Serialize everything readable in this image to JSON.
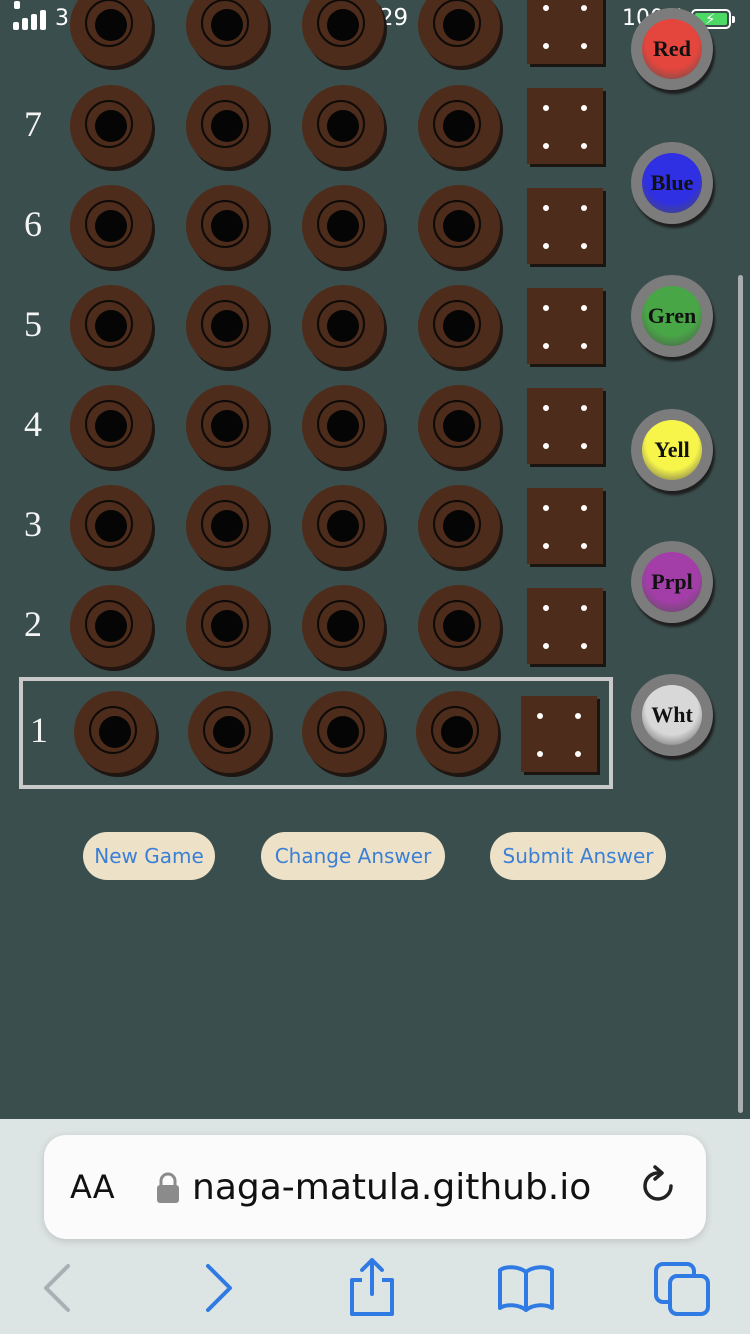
{
  "status_bar": {
    "carrier": "3",
    "time": "21:29",
    "battery_percent": "100%"
  },
  "board": {
    "row_labels": [
      "7",
      "6",
      "5",
      "4",
      "3",
      "2",
      "1"
    ],
    "active_row": "1"
  },
  "palette": {
    "colors": [
      {
        "label": "Red",
        "color": "#e4453d"
      },
      {
        "label": "Blue",
        "color": "#2f2fe4"
      },
      {
        "label": "Gren",
        "color": "#48a646"
      },
      {
        "label": "Yell",
        "color": "#f7f54a"
      },
      {
        "label": "Prpl",
        "color": "#a33ea8"
      },
      {
        "label": "Wht",
        "color": "#d8d8d8"
      }
    ]
  },
  "actions": {
    "new_game": "New Game",
    "change_answer": "Change Answer",
    "submit_answer": "Submit Answer"
  },
  "browser": {
    "text_size_label": "AA",
    "url": "naga-matula.github.io",
    "toolbar_icons": [
      "back-icon",
      "forward-icon",
      "share-icon",
      "bookmarks-icon",
      "tabs-icon"
    ]
  }
}
